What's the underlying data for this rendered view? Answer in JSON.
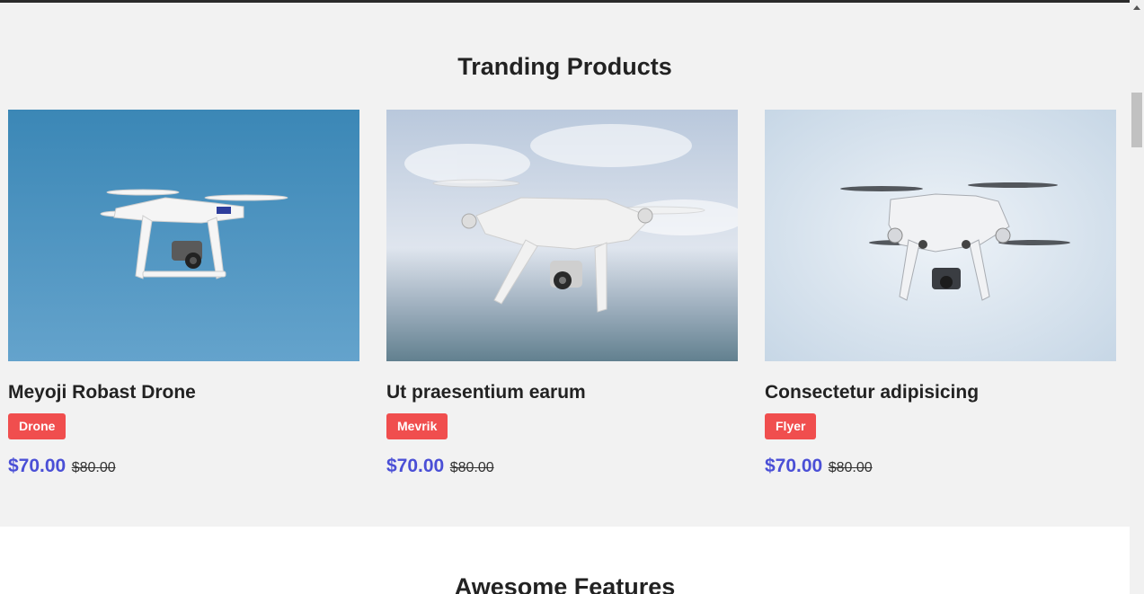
{
  "sections": {
    "products_title": "Tranding Products",
    "features_title": "Awesome Features"
  },
  "products": [
    {
      "name": "Meyoji Robast Drone",
      "tag": "Drone",
      "price": "$70.00",
      "old_price": "$80.00"
    },
    {
      "name": "Ut praesentium earum",
      "tag": "Mevrik",
      "price": "$70.00",
      "old_price": "$80.00"
    },
    {
      "name": "Consectetur adipisicing",
      "tag": "Flyer",
      "price": "$70.00",
      "old_price": "$80.00"
    }
  ],
  "colors": {
    "accent": "#4a4fd6",
    "badge": "#f04e4e",
    "section_bg": "#f2f2f2"
  }
}
